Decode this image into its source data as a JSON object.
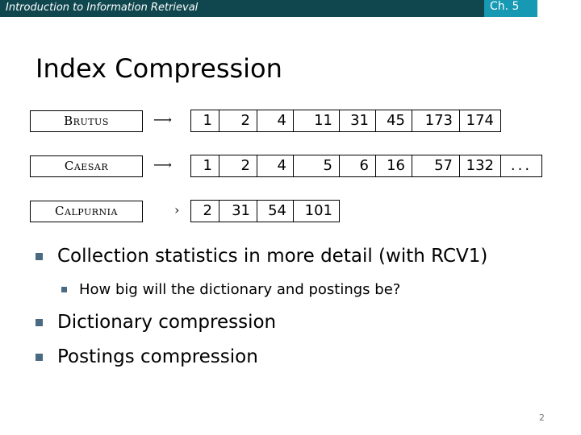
{
  "header": {
    "course_title": "Introduction to Information Retrieval",
    "chapter": "Ch. 5",
    "colors": {
      "header_bg": "#10474f",
      "chapter_bg": "#1798b3",
      "bullet": "#4a6a82"
    }
  },
  "slide": {
    "title": "Index Compression",
    "figure": {
      "rows": [
        {
          "term": "Brutus",
          "arrow": "⟶",
          "postings": [
            "1",
            "2",
            "4",
            "11",
            "31",
            "45",
            "173",
            "174"
          ]
        },
        {
          "term": "Caesar",
          "arrow": "⟶",
          "postings": [
            "1",
            "2",
            "4",
            "5",
            "6",
            "16",
            "57",
            "132",
            "..."
          ]
        },
        {
          "term": "Calpurnia",
          "arrow": "›",
          "postings": [
            "2",
            "31",
            "54",
            "101"
          ]
        }
      ]
    },
    "bullets": [
      {
        "level": 1,
        "text": "Collection statistics in more detail (with RCV1)"
      },
      {
        "level": 2,
        "text": "How big will the dictionary and postings be?"
      },
      {
        "level": 1,
        "text": "Dictionary compression"
      },
      {
        "level": 1,
        "text": "Postings compression"
      }
    ],
    "page_number": "2"
  }
}
